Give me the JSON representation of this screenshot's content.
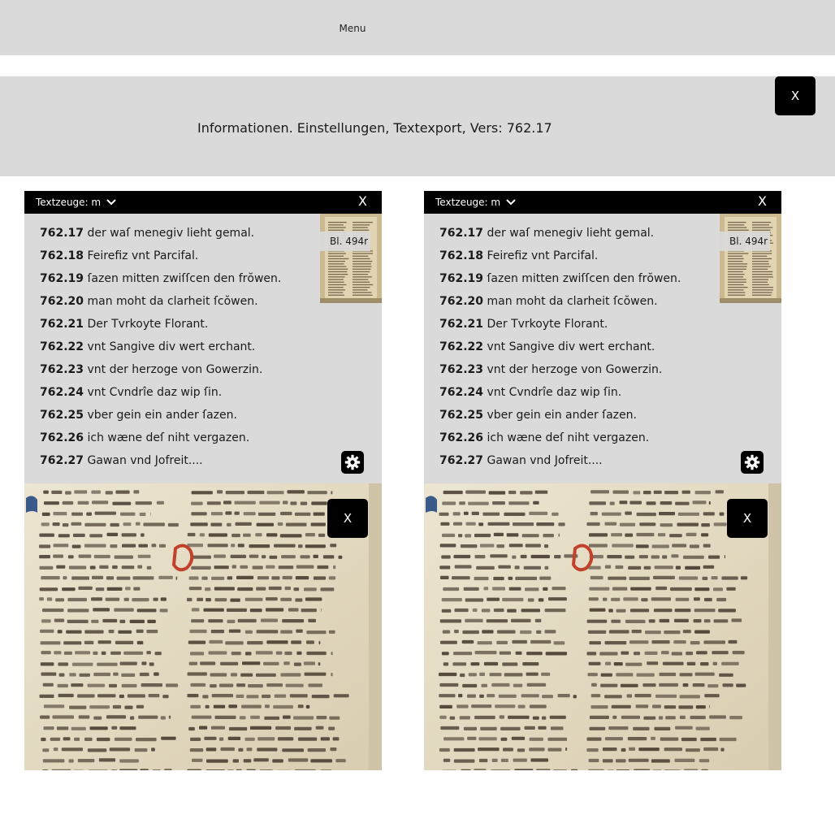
{
  "topbar": {
    "menu_label": "Menu"
  },
  "infobar": {
    "text": "Informationen. Einstellungen, Textexport, Vers: 762.17",
    "close_label": "X"
  },
  "panels": [
    {
      "witness_label": "Textzeuge: m",
      "close_label": "X",
      "thumbnail_label": "Bl. 494r",
      "manuscript_close_label": "X",
      "verses": [
        {
          "num": "762.17",
          "text": "der waſ menegiv lieht gemal."
        },
        {
          "num": "762.18",
          "text": "Feirefiz vnt Parcifal."
        },
        {
          "num": "762.19",
          "text": "ſazen mitten zwiſſcen den frŏwen."
        },
        {
          "num": "762.20",
          "text": "man moht da clarheit ſcŏwen."
        },
        {
          "num": "762.21",
          "text": "Der Tvrkoyte Florant."
        },
        {
          "num": "762.22",
          "text": "vnt Sangive div wert erchant."
        },
        {
          "num": "762.23",
          "text": "vnt der herzoge von Gowerzin."
        },
        {
          "num": "762.24",
          "text": "vnt Cvndrîe daz wip ſin."
        },
        {
          "num": "762.25",
          "text": "vber gein ein ander ſazen."
        },
        {
          "num": "762.26",
          "text": "ich wæne deſ niht vergazen."
        },
        {
          "num": "762.27",
          "text": "Gawan vnd Jofreit...."
        }
      ]
    },
    {
      "witness_label": "Textzeuge: m",
      "close_label": "X",
      "thumbnail_label": "Bl. 494r",
      "manuscript_close_label": "X",
      "verses": [
        {
          "num": "762.17",
          "text": "der waſ menegiv lieht gemal."
        },
        {
          "num": "762.18",
          "text": "Feirefiz vnt Parcifal."
        },
        {
          "num": "762.19",
          "text": "ſazen mitten zwiſſcen den frŏwen."
        },
        {
          "num": "762.20",
          "text": "man moht da clarheit ſcŏwen."
        },
        {
          "num": "762.21",
          "text": "Der Tvrkoyte Florant."
        },
        {
          "num": "762.22",
          "text": "vnt Sangive div wert erchant."
        },
        {
          "num": "762.23",
          "text": "vnt der herzoge von Gowerzin."
        },
        {
          "num": "762.24",
          "text": "vnt Cvndrîe daz wip ſin."
        },
        {
          "num": "762.25",
          "text": "vber gein ein ander ſazen."
        },
        {
          "num": "762.26",
          "text": "ich wæne deſ niht vergazen."
        },
        {
          "num": "762.27",
          "text": "Gawan vnd Jofreit...."
        }
      ]
    }
  ],
  "icons": {
    "witness_dropdown": "chevron-down-icon",
    "settings": "gear-icon",
    "close": "close-icon"
  },
  "colors": {
    "bar_background": "#dadada",
    "header_background": "#000000",
    "button_background": "#000000",
    "parchment": "#e4dcc6",
    "initial_red": "#c2412a",
    "initial_blue": "#3a5a8a"
  }
}
